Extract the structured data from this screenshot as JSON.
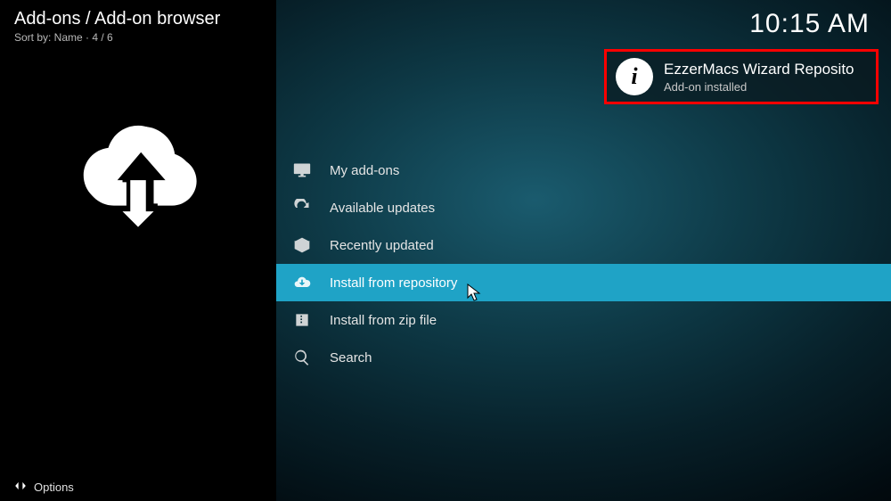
{
  "header": {
    "breadcrumb": "Add-ons / Add-on browser",
    "sort_line": "Sort by: Name  ·  4 / 6"
  },
  "clock": "10:15 AM",
  "menu": {
    "items": [
      {
        "icon": "monitor-icon",
        "label": "My add-ons"
      },
      {
        "icon": "refresh-icon",
        "label": "Available updates"
      },
      {
        "icon": "box-open-icon",
        "label": "Recently updated"
      },
      {
        "icon": "cloud-download-icon",
        "label": "Install from repository"
      },
      {
        "icon": "zip-box-icon",
        "label": "Install from zip file"
      },
      {
        "icon": "search-icon",
        "label": "Search"
      }
    ],
    "selected_index": 3
  },
  "notification": {
    "title": "EzzerMacs Wizard Reposito",
    "subtitle": "Add-on installed"
  },
  "footer": {
    "options_label": "Options"
  }
}
